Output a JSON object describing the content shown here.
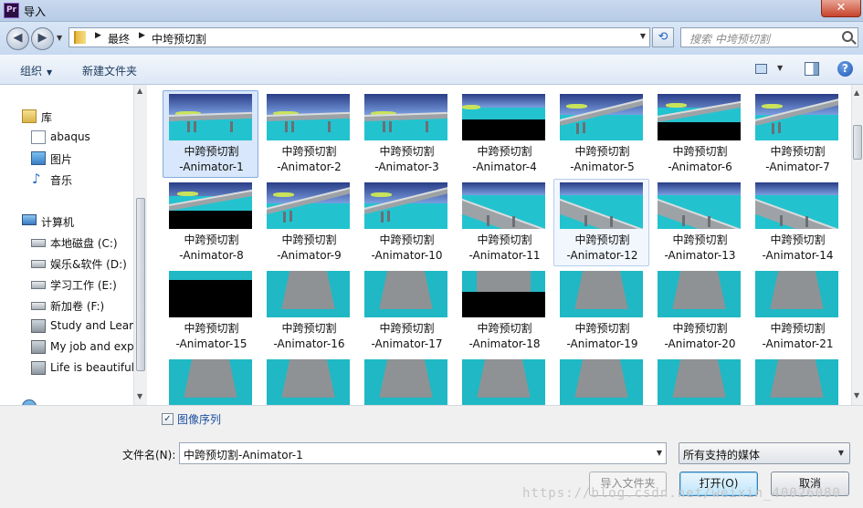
{
  "window": {
    "title": "导入",
    "app_icon_text": "Pr",
    "close_glyph": "✕"
  },
  "address": {
    "crumbs": [
      "最终",
      "中垮预切割"
    ],
    "search_placeholder": "搜索 中垮预切割"
  },
  "toolbar": {
    "organize_label": "组织",
    "new_folder_label": "新建文件夹"
  },
  "sidebar": {
    "items": [
      {
        "label": "库",
        "icon": "library-icon"
      },
      {
        "label": "abaqus",
        "icon": "document-library-icon"
      },
      {
        "label": "图片",
        "icon": "pictures-icon"
      },
      {
        "label": "音乐",
        "icon": "music-icon"
      },
      {
        "label": "计算机",
        "icon": "computer-icon"
      },
      {
        "label": "本地磁盘 (C:)",
        "icon": "local-disk-icon"
      },
      {
        "label": "娱乐&软件 (D:)",
        "icon": "drive-icon"
      },
      {
        "label": "学习工作 (E:)",
        "icon": "drive-icon"
      },
      {
        "label": "新加卷 (F:)",
        "icon": "drive-icon"
      },
      {
        "label": "Study and Learn",
        "icon": "network-drive-icon"
      },
      {
        "label": "My job and exp",
        "icon": "network-drive-icon"
      },
      {
        "label": "Life is beautiful",
        "icon": "network-drive-icon"
      }
    ]
  },
  "files": [
    {
      "line1": "中跨预切割",
      "line2": "-Animator-1",
      "scene": "sea-bridge"
    },
    {
      "line1": "中跨预切割",
      "line2": "-Animator-2",
      "scene": "sea-bridge"
    },
    {
      "line1": "中跨预切割",
      "line2": "-Animator-3",
      "scene": "sea-bridge"
    },
    {
      "line1": "中跨预切割",
      "line2": "-Animator-4",
      "scene": "sea-black"
    },
    {
      "line1": "中跨预切割",
      "line2": "-Animator-5",
      "scene": "bridge-angle"
    },
    {
      "line1": "中跨预切割",
      "line2": "-Animator-6",
      "scene": "bridge-black"
    },
    {
      "line1": "中跨预切割",
      "line2": "-Animator-7",
      "scene": "bridge-angle"
    },
    {
      "line1": "中跨预切割",
      "line2": "-Animator-8",
      "scene": "bridge-black"
    },
    {
      "line1": "中跨预切割",
      "line2": "-Animator-9",
      "scene": "bridge-angle"
    },
    {
      "line1": "中跨预切割",
      "line2": "-Animator-10",
      "scene": "bridge-angle"
    },
    {
      "line1": "中跨预切割",
      "line2": "-Animator-11",
      "scene": "bridge-close"
    },
    {
      "line1": "中跨预切割",
      "line2": "-Animator-12",
      "scene": "bridge-close"
    },
    {
      "line1": "中跨预切割",
      "line2": "-Animator-13",
      "scene": "bridge-close"
    },
    {
      "line1": "中跨预切割",
      "line2": "-Animator-14",
      "scene": "bridge-close"
    },
    {
      "line1": "中跨预切割",
      "line2": "-Animator-15",
      "scene": "black-top"
    },
    {
      "line1": "中跨预切割",
      "line2": "-Animator-16",
      "scene": "road"
    },
    {
      "line1": "中跨预切割",
      "line2": "-Animator-17",
      "scene": "road"
    },
    {
      "line1": "中跨预切割",
      "line2": "-Animator-18",
      "scene": "road-black"
    },
    {
      "line1": "中跨预切割",
      "line2": "-Animator-19",
      "scene": "road"
    },
    {
      "line1": "中跨预切割",
      "line2": "-Animator-20",
      "scene": "road"
    },
    {
      "line1": "中跨预切割",
      "line2": "-Animator-21",
      "scene": "road"
    }
  ],
  "selected_file": "-Animator-1",
  "hover_file": "-Animator-12",
  "bottom": {
    "image_sequence_label": "图像序列",
    "image_sequence_checked": true,
    "filename_label": "文件名(N):",
    "filename_value": "中跨预切割-Animator-1",
    "filetype_value": "所有支持的媒体",
    "import_folder_label": "导入文件夹",
    "open_label": "打开(O)",
    "cancel_label": "取消"
  },
  "watermark": "https://blog.csdn.net/weixin_40026080",
  "colors": {
    "accent": "#3c7fb1",
    "selection": "#d8e7fb",
    "sea": "#22c3cf"
  }
}
